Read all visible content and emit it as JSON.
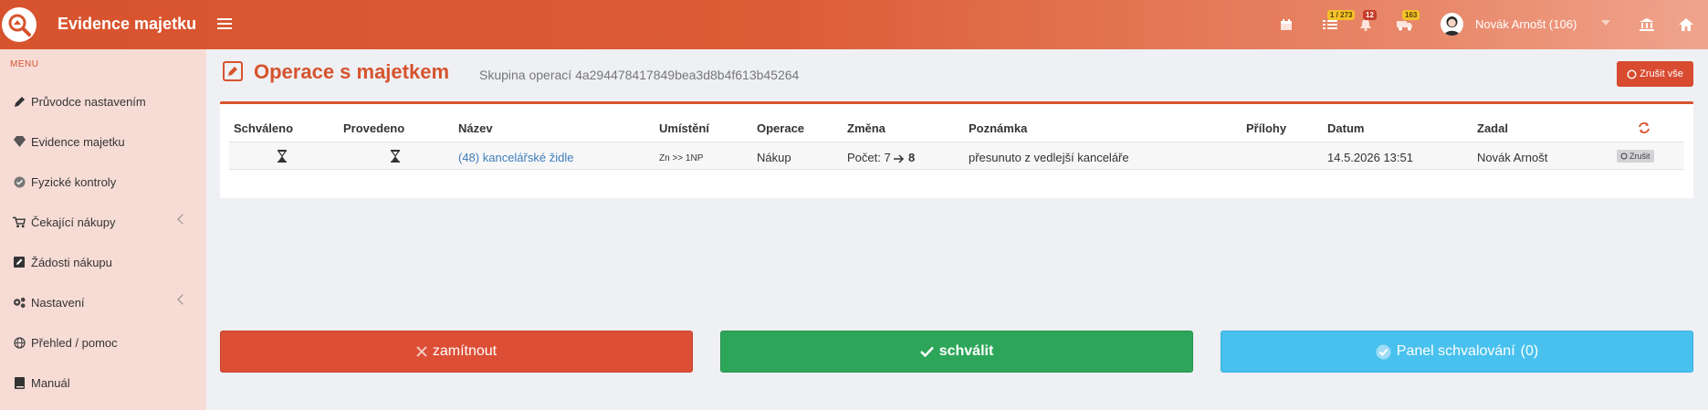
{
  "app": {
    "brand": "Evidence majetku",
    "user_name": "Novák Arnošt (106)",
    "colors": {
      "primary": "#d7532e",
      "success": "#2ea65a",
      "info": "#48c1ee",
      "danger": "#dc4e35"
    }
  },
  "topbar": {
    "badges": {
      "tasks": "1 / 273",
      "alerts": "12",
      "transport": "163"
    },
    "icons": [
      "calendar-icon",
      "tasks-icon",
      "bell-icon",
      "truck-icon",
      "bank-icon",
      "home-icon"
    ]
  },
  "sidebar": {
    "menu_title": "MENU",
    "items": [
      {
        "label": "Průvodce nastavením",
        "icon": "pencil-icon"
      },
      {
        "label": "Evidence majetku",
        "icon": "diamond-icon"
      },
      {
        "label": "Fyzické kontroly",
        "icon": "check-circle-icon"
      },
      {
        "label": "Čekající nákupy",
        "icon": "cart-icon",
        "expandable": true
      },
      {
        "label": "Žádosti nákupu",
        "icon": "edit-square-icon"
      },
      {
        "label": "Nastavení",
        "icon": "cogs-icon",
        "expandable": true
      },
      {
        "label": "Přehled / pomoc",
        "icon": "globe-icon"
      },
      {
        "label": "Manuál",
        "icon": "book-icon"
      }
    ]
  },
  "page": {
    "title": "Operace s majetkem",
    "subtitle": "Skupina operací 4a294478417849bea3d8b4f613b45264",
    "cancel_all_label": "Zrušit vše"
  },
  "table": {
    "headers": [
      "Schváleno",
      "Provedeno",
      "Název",
      "Umístění",
      "Operace",
      "Změna",
      "Poznámka",
      "Přílohy",
      "Datum",
      "Zadal"
    ],
    "rows": [
      {
        "approved": "pending",
        "done": "pending",
        "name": "(48) kancelářské židle",
        "location": "Zn >> 1NP",
        "operation": "Nákup",
        "change_prefix": "Počet: 7",
        "change_to": "8",
        "note": "přesunuto z vedlejší kanceláře",
        "attachments": "",
        "date": "14.5.2026 13:51",
        "entered_by": "Novák Arnošt",
        "cancel_label": "Zrušit"
      }
    ]
  },
  "actions": {
    "reject_label": "zamítnout",
    "approve_label": "schválit",
    "panel_label": "Panel schvalování",
    "panel_count": "(0)"
  }
}
